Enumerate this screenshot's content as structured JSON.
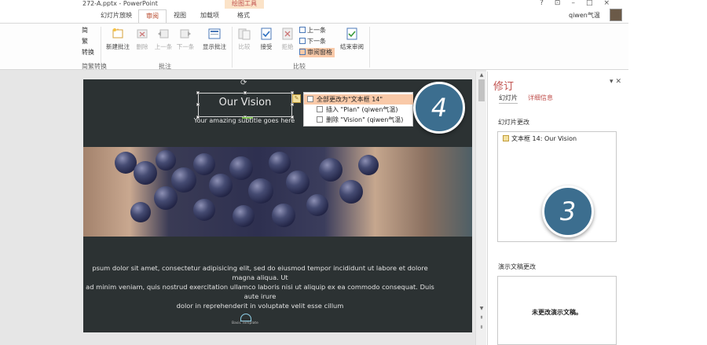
{
  "window": {
    "filename": "272-A.pptx - PowerPoint",
    "context_group": "绘图工具",
    "controls": [
      "?",
      "⊡",
      "–",
      "□",
      "×"
    ]
  },
  "tabs": [
    {
      "label": "幻灯片放映",
      "active": false
    },
    {
      "label": "审阅",
      "active": true
    },
    {
      "label": "视图",
      "active": false
    },
    {
      "label": "加载项",
      "active": false
    },
    {
      "label": "格式",
      "active": false
    }
  ],
  "user": {
    "name": "qiwen气温"
  },
  "ribbon": {
    "partial_left": [
      "简",
      "繁",
      "转换"
    ],
    "partial_group": "简繁转换",
    "comments": {
      "group_label": "批注",
      "new": "新建批注",
      "delete": "删除",
      "prev": "上一条",
      "next": "下一条",
      "show": "显示批注"
    },
    "compare": {
      "group_label": "比较",
      "compare": "比较",
      "accept": "接受",
      "reject": "拒绝",
      "prev": "上一条",
      "next": "下一条",
      "pane": "审阅窗格",
      "end": "结束审阅"
    }
  },
  "slide": {
    "title": "Our Vision",
    "subtitle": "Your amazing subtitle goes here",
    "body": [
      "psum dolor sit amet, consectetur adipisicing elit, sed do eiusmod tempor incididunt ut labore et dolore magna aliqua. Ut",
      "ad minim veniam, quis nostrud exercitation ullamco laboris nisi ut aliquip ex ea commodo consequat. Duis aute irure",
      "dolor in reprehenderit in voluptate velit esse cillum"
    ],
    "logo_text": "Basic Template"
  },
  "popup": {
    "all": "全部更改为\"文本框 14\"",
    "insert": "插入 \"Plan\" (qiwen气温)",
    "delete": "删除 \"Vision\" (qiwen气温)"
  },
  "badges": {
    "slide": "4",
    "pane": "3"
  },
  "pane": {
    "title": "修订",
    "tab_slides": "幻灯片",
    "tab_details": "详细信息",
    "slide_changes_label": "幻灯片更改",
    "slide_change_entry": "文本框 14: Our Vision",
    "doc_changes_label": "演示文稿更改",
    "no_changes": "未更改演示文稿。"
  },
  "colors": {
    "accent": "#c0504d",
    "badge": "#3c6e8f",
    "slide_bg": "#2c3233"
  }
}
